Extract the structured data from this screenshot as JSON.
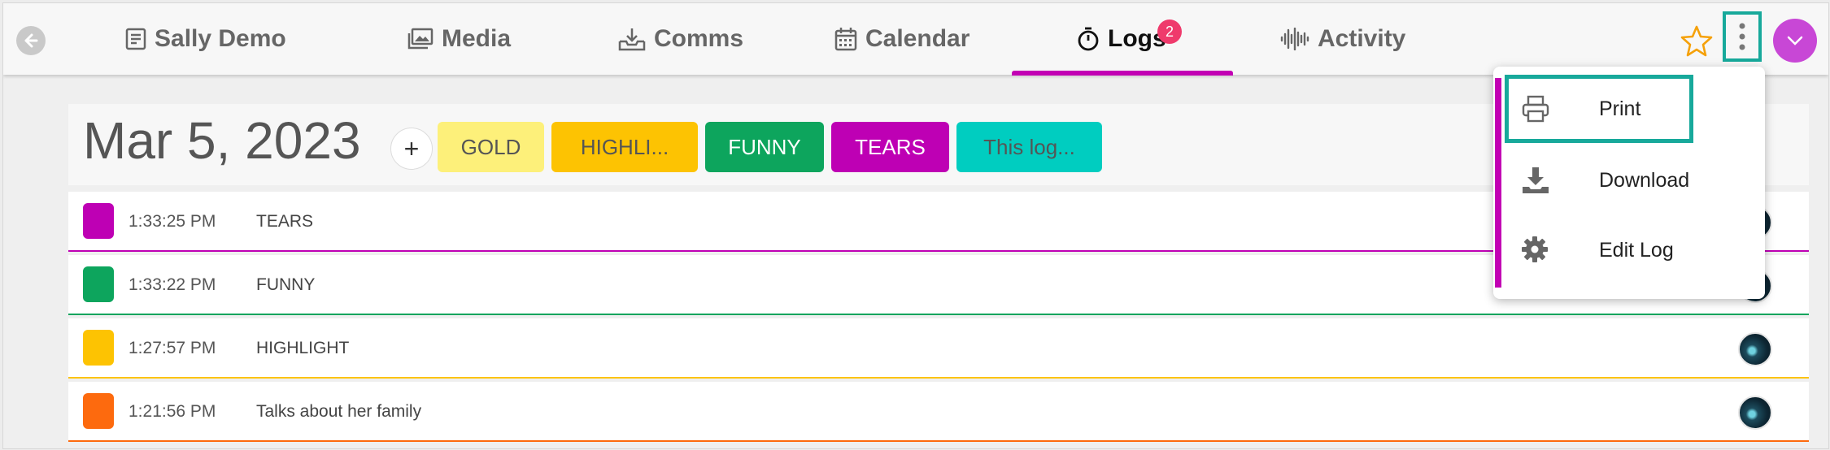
{
  "nav": {
    "tabs": [
      {
        "label": "Sally Demo",
        "icon": "document-icon"
      },
      {
        "label": "Media",
        "icon": "image-icon"
      },
      {
        "label": "Comms",
        "icon": "inbox-download-icon"
      },
      {
        "label": "Calendar",
        "icon": "calendar-icon"
      },
      {
        "label": "Logs",
        "icon": "stopwatch-icon",
        "badge": "2",
        "active": true
      },
      {
        "label": "Activity",
        "icon": "waveform-icon"
      }
    ],
    "accent_color": "#c200b4",
    "highlight_color": "#17a99b"
  },
  "log": {
    "date": "Mar 5, 2023",
    "add_label": "+",
    "chips": [
      {
        "label": "GOLD",
        "color": "#fdf07a"
      },
      {
        "label": "HIGHLI...",
        "color": "#fdc302"
      },
      {
        "label": "FUNNY",
        "color": "#0da55d"
      },
      {
        "label": "TEARS",
        "color": "#be00b4"
      },
      {
        "label": "This log...",
        "color": "#00cdc0"
      }
    ],
    "entries": [
      {
        "time": "1:33:25 PM",
        "label": "TEARS",
        "color": "#be00b4"
      },
      {
        "time": "1:33:22 PM",
        "label": "FUNNY",
        "color": "#0da55d"
      },
      {
        "time": "1:27:57 PM",
        "label": "HIGHLIGHT",
        "color": "#fdc302"
      },
      {
        "time": "1:21:56 PM",
        "label": "Talks about her family",
        "color": "#fd6a0e"
      }
    ]
  },
  "menu": {
    "items": [
      {
        "label": "Print",
        "icon": "printer-icon"
      },
      {
        "label": "Download",
        "icon": "download-icon"
      },
      {
        "label": "Edit Log",
        "icon": "gear-icon"
      }
    ]
  }
}
